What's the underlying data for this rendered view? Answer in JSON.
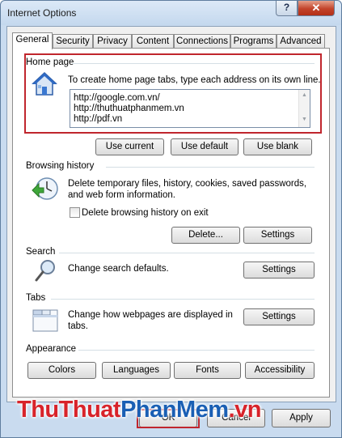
{
  "window": {
    "title": "Internet Options",
    "help_label": "?",
    "close_label": "✕"
  },
  "tabs": [
    "General",
    "Security",
    "Privacy",
    "Content",
    "Connections",
    "Programs",
    "Advanced"
  ],
  "home_page": {
    "label": "Home page",
    "description": "To create home page tabs, type each address on its own line.",
    "urls": [
      "http://google.com.vn/",
      "http://thuthuatphanmem.vn",
      "http://pdf.vn"
    ],
    "buttons": [
      "Use current",
      "Use default",
      "Use blank"
    ]
  },
  "browsing_history": {
    "label": "Browsing history",
    "description": "Delete temporary files, history, cookies, saved passwords, and web form information.",
    "checkbox_label": "Delete browsing history on exit",
    "delete_label": "Delete...",
    "settings_label": "Settings"
  },
  "search": {
    "label": "Search",
    "description": "Change search defaults.",
    "settings_label": "Settings"
  },
  "tabs_section": {
    "label": "Tabs",
    "description": "Change how webpages are displayed in tabs.",
    "settings_label": "Settings"
  },
  "appearance": {
    "label": "Appearance",
    "buttons": [
      "Colors",
      "Languages",
      "Fonts",
      "Accessibility"
    ]
  },
  "footer": {
    "ok_label": "OK",
    "cancel_label": "Cancel",
    "apply_label": "Apply"
  },
  "watermark": {
    "part1": "ThuThuat",
    "part2": "PhanMem",
    "part3": ".vn"
  },
  "colors": {
    "highlight_red": "#c0262d",
    "window_frame": "#c9dbef"
  }
}
